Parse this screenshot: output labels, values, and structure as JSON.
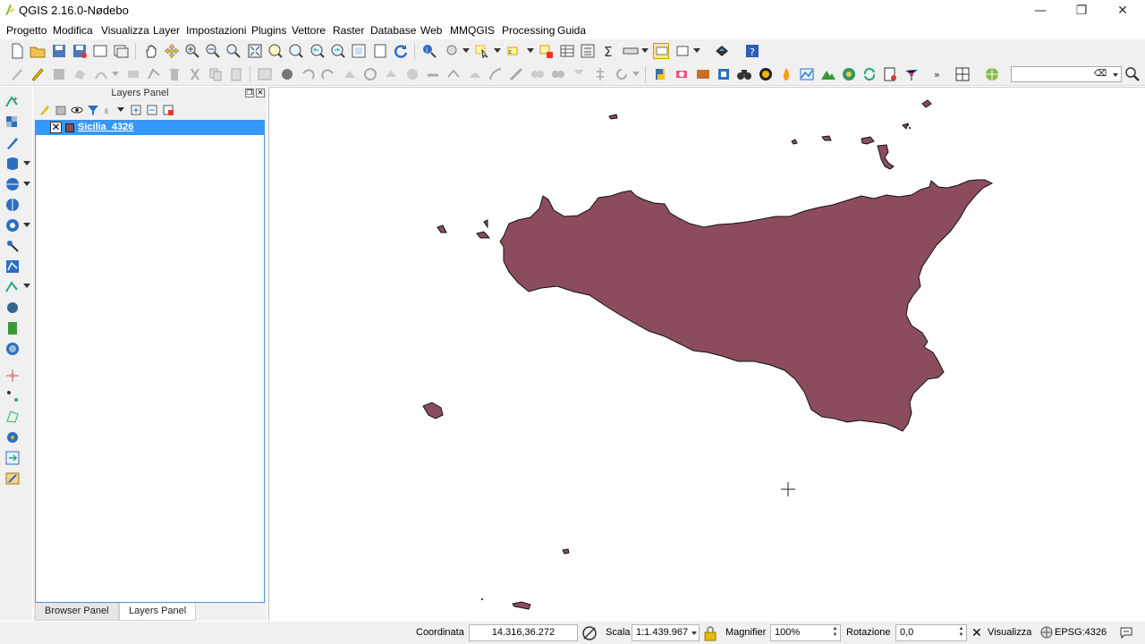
{
  "window": {
    "title": "QGIS 2.16.0-Nødebo",
    "minimize": "—",
    "restore": "❐",
    "close": "✕"
  },
  "menu": [
    "Progetto",
    "Modifica",
    "Visualizza",
    "Layer",
    "Impostazioni",
    "Plugins",
    "Vettore",
    "Raster",
    "Database",
    "Web",
    "MMQGIS",
    "Processing",
    "Guida"
  ],
  "layers_panel": {
    "title": "Layers Panel",
    "layers": [
      {
        "name": "Sicilia_4326",
        "checked": true,
        "checkmark": "✕",
        "fill_color": "#8b4d5e"
      }
    ]
  },
  "bottom_tabs": [
    "Browser Panel",
    "Layers Panel"
  ],
  "active_tab": "Layers Panel",
  "map": {
    "fill_color": "#8b4d5e",
    "cursor": "crosshair"
  },
  "status": {
    "coord_label": "Coordinata",
    "coord_value": "14.316,36.272",
    "scale_label": "Scala",
    "scale_value": "1:1.439.967",
    "magnifier_label": "Magnifier",
    "magnifier_value": "100%",
    "rotation_label": "Rotazione",
    "rotation_value": "0,0",
    "render_label": "Visualizza",
    "render_mark": "✕",
    "crs": "EPSG:4326"
  },
  "search": {
    "placeholder": ""
  }
}
